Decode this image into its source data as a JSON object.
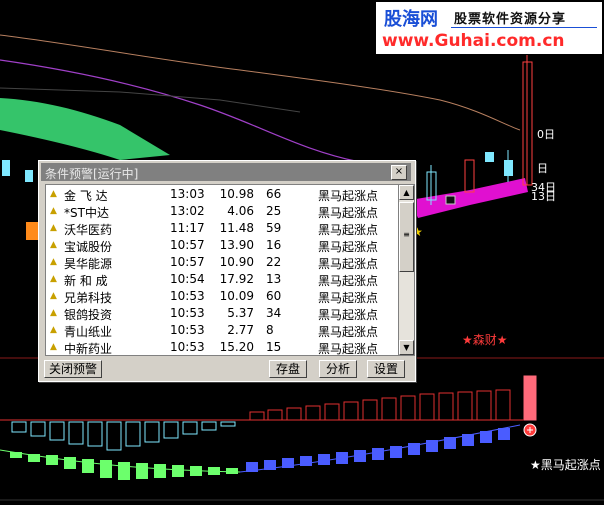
{
  "banner": {
    "brand": "股海网",
    "tagline": "股票软件资源分享",
    "url": "www.Guhai.com.cn"
  },
  "chart_labels": {
    "right_0": "0日",
    "right_day": "日",
    "right_34": "34日",
    "right_13": "13日",
    "star_senecai": "★森财★",
    "bottom_signal": "★黑马起涨点"
  },
  "dialog": {
    "title": "条件预警[运行中]",
    "close_label": "×",
    "rows": [
      {
        "name": "金 飞 达",
        "time": "13:03",
        "price": "10.98",
        "num": "66",
        "signal": "黑马起涨点"
      },
      {
        "name": "*ST中达",
        "time": "13:02",
        "price": "4.06",
        "num": "25",
        "signal": "黑马起涨点"
      },
      {
        "name": "沃华医药",
        "time": "11:17",
        "price": "11.48",
        "num": "59",
        "signal": "黑马起涨点"
      },
      {
        "name": "宝诚股份",
        "time": "10:57",
        "price": "13.90",
        "num": "16",
        "signal": "黑马起涨点"
      },
      {
        "name": "昊华能源",
        "time": "10:57",
        "price": "10.90",
        "num": "22",
        "signal": "黑马起涨点"
      },
      {
        "name": "新 和 成",
        "time": "10:54",
        "price": "17.92",
        "num": "13",
        "signal": "黑马起涨点"
      },
      {
        "name": "兄弟科技",
        "time": "10:53",
        "price": "10.09",
        "num": "60",
        "signal": "黑马起涨点"
      },
      {
        "name": "银鸽投资",
        "time": "10:53",
        "price": "5.37",
        "num": "34",
        "signal": "黑马起涨点"
      },
      {
        "name": "青山纸业",
        "time": "10:53",
        "price": "2.77",
        "num": "8",
        "signal": "黑马起涨点"
      },
      {
        "name": "中新药业",
        "time": "10:53",
        "price": "15.20",
        "num": "15",
        "signal": "黑马起涨点"
      }
    ],
    "buttons": {
      "close_alert": "关闭预警",
      "save": "存盘",
      "analyze": "分析",
      "settings": "设置"
    }
  },
  "colors": {
    "background": "#000000",
    "green_band": "#35c46a",
    "magenta_band": "#e010d0",
    "cyan_candle": "#7fe8ff",
    "red_hist": "#e03030",
    "blue_hist": "#4a5cff",
    "green_hist": "#6cff6c"
  }
}
